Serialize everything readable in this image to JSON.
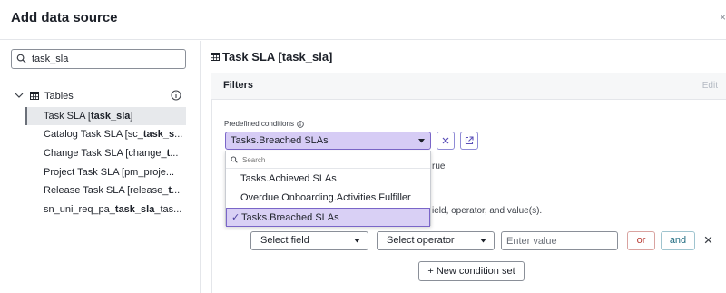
{
  "dialog": {
    "title": "Add data source",
    "close_glyph": "×"
  },
  "left_panel": {
    "search": {
      "value": "task_sla",
      "placeholder": ""
    },
    "tree": {
      "group_label": "Tables",
      "items": [
        {
          "pre": "Task SLA [",
          "bold": "task_sla",
          "post": "]"
        },
        {
          "pre": "Catalog Task SLA [sc_",
          "bold": "task_s",
          "post": "..."
        },
        {
          "pre": "Change Task SLA [change_",
          "bold": "t",
          "post": "..."
        },
        {
          "pre": "Project Task SLA [pm_proje",
          "bold": "",
          "post": "..."
        },
        {
          "pre": "Release Task SLA [release_",
          "bold": "t",
          "post": "..."
        },
        {
          "pre": "sn_uni_req_pa_",
          "bold": "task_sla",
          "post": "_tas..."
        }
      ]
    }
  },
  "right_panel": {
    "title": "Task SLA [task_sla]",
    "filters_label": "Filters",
    "edit_label": "Edit",
    "predefined": {
      "label": "Predefined conditions",
      "selected": "Tasks.Breached SLAs",
      "behind_text_1": "rue",
      "behind_text_2": "ield, operator, and value(s).",
      "dropdown": {
        "search_placeholder": "Search",
        "options": [
          "Tasks.Achieved SLAs",
          "Overdue.Onboarding.Activities.Fulfiller",
          "Tasks.Breached SLAs"
        ],
        "check_glyph": "✓"
      }
    },
    "condition": {
      "field_label": "Select field",
      "operator_label": "Select operator",
      "value_placeholder": "Enter value",
      "or_label": "or",
      "and_label": "and"
    },
    "new_condition_set_label": "+ New condition set"
  },
  "colors": {
    "accent": "#7a66c8",
    "selected_fill": "#d6ccf5",
    "or_text": "#b83a32",
    "and_text": "#1f6b80"
  }
}
